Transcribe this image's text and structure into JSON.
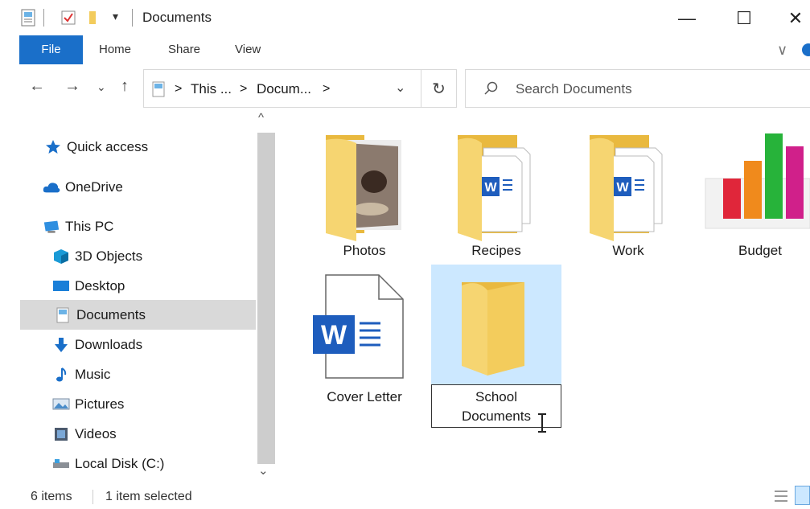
{
  "window": {
    "title": "Documents",
    "qa_dropdown_glyph": "▾"
  },
  "window_controls": {
    "minimize": "—",
    "maximize": "☐",
    "close": "✕"
  },
  "ribbon": {
    "tabs": [
      "File",
      "Home",
      "Share",
      "View"
    ],
    "expand_glyph": "∨"
  },
  "navigation": {
    "back": "←",
    "forward": "→",
    "recent": "⌄",
    "up": "↑",
    "breadcrumb": [
      "This ...",
      "Docum..."
    ],
    "crumb_separator": ">",
    "dropdown": "⌄",
    "refresh": "↻"
  },
  "search": {
    "placeholder": "Search Documents"
  },
  "sidebar": {
    "scroll_up": "^",
    "scroll_down": "⌄",
    "items": [
      {
        "label": "Quick access",
        "icon": "star-icon"
      },
      {
        "label": "OneDrive",
        "icon": "cloud-icon"
      },
      {
        "label": "This PC",
        "icon": "computer-icon"
      },
      {
        "label": "3D Objects",
        "icon": "cube-icon"
      },
      {
        "label": "Desktop",
        "icon": "desktop-icon"
      },
      {
        "label": "Documents",
        "icon": "documents-icon",
        "selected": true
      },
      {
        "label": "Downloads",
        "icon": "download-arrow-icon"
      },
      {
        "label": "Music",
        "icon": "music-note-icon"
      },
      {
        "label": "Pictures",
        "icon": "pictures-icon"
      },
      {
        "label": "Videos",
        "icon": "videos-icon"
      },
      {
        "label": "Local Disk (C:)",
        "icon": "disk-icon"
      }
    ]
  },
  "files": [
    {
      "name": "Photos",
      "type": "folder-photos"
    },
    {
      "name": "Recipes",
      "type": "folder-word"
    },
    {
      "name": "Work",
      "type": "folder-word"
    },
    {
      "name": "Budget",
      "type": "chart-file"
    },
    {
      "name": "Cover Letter",
      "type": "word-document"
    },
    {
      "name": "School Documents",
      "line1": "School",
      "line2": "Documents",
      "type": "folder",
      "selected": true,
      "renaming": true
    }
  ],
  "status": {
    "items_count": "6 items",
    "selection": "1 item selected"
  },
  "colors": {
    "accent": "#1a6fc9",
    "selection": "#cce8ff",
    "folder": "#f3cc5c",
    "word_blue": "#1e5dbd"
  }
}
